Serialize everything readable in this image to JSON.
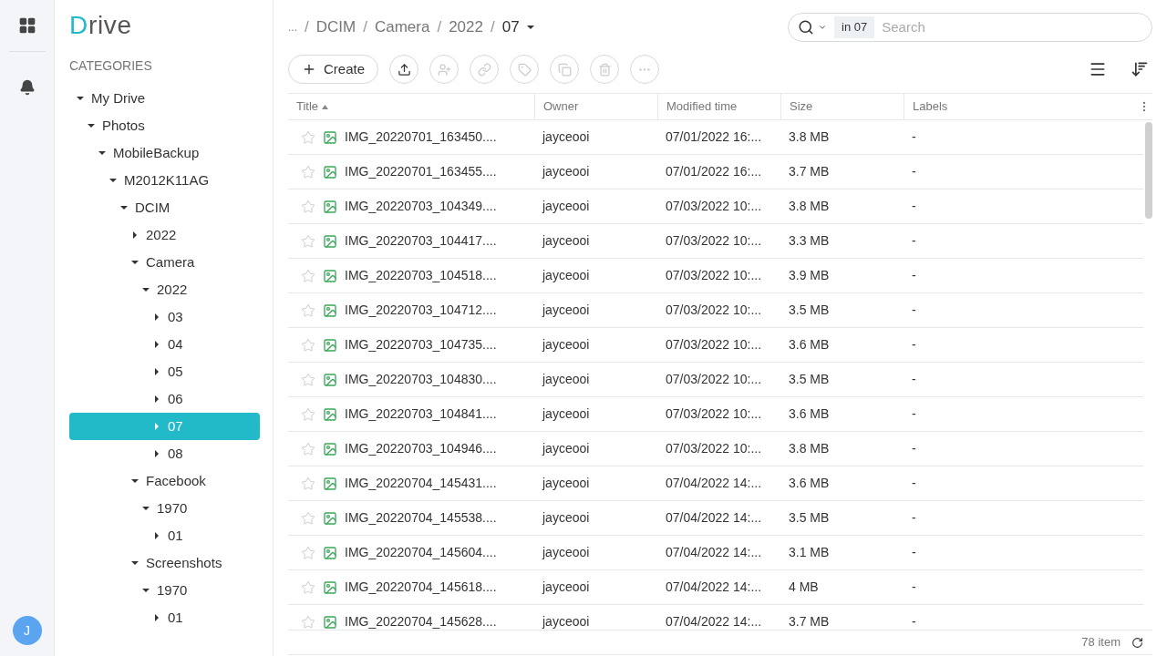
{
  "logo": {
    "first": "D",
    "rest": "rive"
  },
  "sidebar": {
    "heading": "CATEGORIES",
    "tree": [
      {
        "label": "My Drive",
        "expanded": true,
        "selected": false,
        "children": [
          {
            "label": "Photos",
            "expanded": true,
            "selected": false,
            "children": [
              {
                "label": "MobileBackup",
                "expanded": true,
                "selected": false,
                "children": [
                  {
                    "label": "M2012K11AG",
                    "expanded": true,
                    "selected": false,
                    "children": [
                      {
                        "label": "DCIM",
                        "expanded": true,
                        "selected": false,
                        "children": [
                          {
                            "label": "2022",
                            "expanded": false,
                            "selected": false
                          },
                          {
                            "label": "Camera",
                            "expanded": true,
                            "selected": false,
                            "children": [
                              {
                                "label": "2022",
                                "expanded": true,
                                "selected": false,
                                "children": [
                                  {
                                    "label": "03",
                                    "expanded": false,
                                    "selected": false
                                  },
                                  {
                                    "label": "04",
                                    "expanded": false,
                                    "selected": false
                                  },
                                  {
                                    "label": "05",
                                    "expanded": false,
                                    "selected": false
                                  },
                                  {
                                    "label": "06",
                                    "expanded": false,
                                    "selected": false
                                  },
                                  {
                                    "label": "07",
                                    "expanded": false,
                                    "selected": true
                                  },
                                  {
                                    "label": "08",
                                    "expanded": false,
                                    "selected": false
                                  }
                                ]
                              }
                            ]
                          },
                          {
                            "label": "Facebook",
                            "expanded": true,
                            "selected": false,
                            "children": [
                              {
                                "label": "1970",
                                "expanded": true,
                                "selected": false,
                                "children": [
                                  {
                                    "label": "01",
                                    "expanded": false,
                                    "selected": false
                                  }
                                ]
                              }
                            ]
                          },
                          {
                            "label": "Screenshots",
                            "expanded": true,
                            "selected": false,
                            "children": [
                              {
                                "label": "1970",
                                "expanded": true,
                                "selected": false,
                                "children": [
                                  {
                                    "label": "01",
                                    "expanded": false,
                                    "selected": false
                                  }
                                ]
                              }
                            ]
                          }
                        ]
                      }
                    ]
                  }
                ]
              }
            ]
          }
        ]
      }
    ]
  },
  "avatar": "J",
  "breadcrumb": {
    "items": [
      "...",
      "DCIM",
      "Camera",
      "2022",
      "07"
    ],
    "separators": [
      "/",
      "/",
      "/",
      "/"
    ]
  },
  "search": {
    "scope": "in 07",
    "placeholder": "Search"
  },
  "toolbar": {
    "create": "Create",
    "actions": [
      {
        "kind": "upload",
        "disabled": false
      },
      {
        "kind": "share",
        "disabled": true
      },
      {
        "kind": "link",
        "disabled": true
      },
      {
        "kind": "tag",
        "disabled": true
      },
      {
        "kind": "copy",
        "disabled": true
      },
      {
        "kind": "delete",
        "disabled": true
      },
      {
        "kind": "more",
        "disabled": true
      }
    ]
  },
  "table": {
    "columns": [
      {
        "label": "Title",
        "sorted": true
      },
      {
        "label": "Owner",
        "sorted": false
      },
      {
        "label": "Modified time",
        "sorted": false
      },
      {
        "label": "Size",
        "sorted": false
      },
      {
        "label": "Labels",
        "sorted": false
      }
    ],
    "rows": [
      {
        "title": "IMG_20220701_163450....",
        "owner": "jayceooi",
        "modified": "07/01/2022 16:...",
        "size": "3.8 MB",
        "labels": "-",
        "starred": false
      },
      {
        "title": "IMG_20220701_163455....",
        "owner": "jayceooi",
        "modified": "07/01/2022 16:...",
        "size": "3.7 MB",
        "labels": "-",
        "starred": false
      },
      {
        "title": "IMG_20220703_104349....",
        "owner": "jayceooi",
        "modified": "07/03/2022 10:...",
        "size": "3.8 MB",
        "labels": "-",
        "starred": false
      },
      {
        "title": "IMG_20220703_104417....",
        "owner": "jayceooi",
        "modified": "07/03/2022 10:...",
        "size": "3.3 MB",
        "labels": "-",
        "starred": false
      },
      {
        "title": "IMG_20220703_104518....",
        "owner": "jayceooi",
        "modified": "07/03/2022 10:...",
        "size": "3.9 MB",
        "labels": "-",
        "starred": false
      },
      {
        "title": "IMG_20220703_104712....",
        "owner": "jayceooi",
        "modified": "07/03/2022 10:...",
        "size": "3.5 MB",
        "labels": "-",
        "starred": false
      },
      {
        "title": "IMG_20220703_104735....",
        "owner": "jayceooi",
        "modified": "07/03/2022 10:...",
        "size": "3.6 MB",
        "labels": "-",
        "starred": false
      },
      {
        "title": "IMG_20220703_104830....",
        "owner": "jayceooi",
        "modified": "07/03/2022 10:...",
        "size": "3.5 MB",
        "labels": "-",
        "starred": false
      },
      {
        "title": "IMG_20220703_104841....",
        "owner": "jayceooi",
        "modified": "07/03/2022 10:...",
        "size": "3.6 MB",
        "labels": "-",
        "starred": false
      },
      {
        "title": "IMG_20220703_104946....",
        "owner": "jayceooi",
        "modified": "07/03/2022 10:...",
        "size": "3.8 MB",
        "labels": "-",
        "starred": false
      },
      {
        "title": "IMG_20220704_145431....",
        "owner": "jayceooi",
        "modified": "07/04/2022 14:...",
        "size": "3.6 MB",
        "labels": "-",
        "starred": false
      },
      {
        "title": "IMG_20220704_145538....",
        "owner": "jayceooi",
        "modified": "07/04/2022 14:...",
        "size": "3.5 MB",
        "labels": "-",
        "starred": false
      },
      {
        "title": "IMG_20220704_145604....",
        "owner": "jayceooi",
        "modified": "07/04/2022 14:...",
        "size": "3.1 MB",
        "labels": "-",
        "starred": false
      },
      {
        "title": "IMG_20220704_145618....",
        "owner": "jayceooi",
        "modified": "07/04/2022 14:...",
        "size": "4 MB",
        "labels": "-",
        "starred": false
      },
      {
        "title": "IMG_20220704_145628....",
        "owner": "jayceooi",
        "modified": "07/04/2022 14:...",
        "size": "3.7 MB",
        "labels": "-",
        "starred": false
      }
    ]
  },
  "footer": {
    "count": "78 item"
  }
}
